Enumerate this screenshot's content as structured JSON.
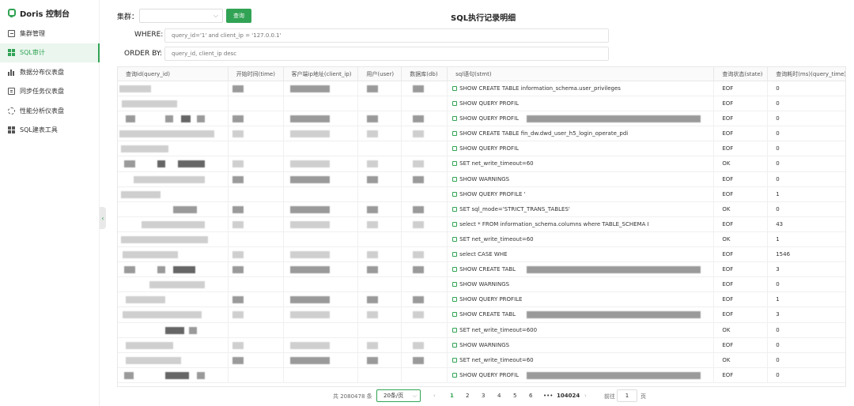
{
  "app": {
    "title": "Doris 控制台"
  },
  "sidebar": {
    "items": [
      {
        "label": "集群管理",
        "icon": "cluster-icon"
      },
      {
        "label": "SQL审计",
        "icon": "grid-icon",
        "active": true
      },
      {
        "label": "数据分布仪表盘",
        "icon": "bar-chart-icon"
      },
      {
        "label": "同步任务仪表盘",
        "icon": "document-icon"
      },
      {
        "label": "性能分析仪表盘",
        "icon": "gear-icon"
      },
      {
        "label": "SQL建表工具",
        "icon": "tiles-icon"
      }
    ]
  },
  "filters": {
    "cluster_label": "集群：",
    "query_button": "查询",
    "where_label": "WHERE:",
    "where_placeholder": "query_id='1' and client_ip = '127.0.0.1'",
    "order_label": "ORDER BY:",
    "order_placeholder": "query_id, client_ip desc"
  },
  "page_title": "SQL执行记录明细",
  "table": {
    "columns": [
      "查询id(query_id)",
      "开始时间(time)",
      "客户端ip地址(client_ip)",
      "用户(user)",
      "数据库(db)",
      "sql语句(stmt)",
      "查询状态(state)",
      "查询耗时(ms)(query_time)"
    ],
    "rows": [
      {
        "stmt": "SHOW CREATE TABLE information_schema.user_privileges",
        "state": "EOF",
        "time": "0"
      },
      {
        "stmt": "SHOW QUERY PROFIL",
        "state": "EOF",
        "time": "0"
      },
      {
        "stmt": "SHOW QUERY PROFIL",
        "state": "EOF",
        "time": "0"
      },
      {
        "stmt": "SHOW CREATE TABLE fin_dw.dwd_user_h5_login_operate_pdi",
        "state": "EOF",
        "time": "0"
      },
      {
        "stmt": "SHOW QUERY PROFIL",
        "state": "EOF",
        "time": "0"
      },
      {
        "stmt": "SET net_write_timeout=60",
        "state": "OK",
        "time": "0"
      },
      {
        "stmt": "SHOW WARNINGS",
        "state": "EOF",
        "time": "0"
      },
      {
        "stmt": "SHOW QUERY PROFILE '",
        "state": "EOF",
        "time": "1"
      },
      {
        "stmt": "SET sql_mode='STRICT_TRANS_TABLES'",
        "state": "OK",
        "time": "0"
      },
      {
        "stmt": "select * FROM information_schema.columns where TABLE_SCHEMA I",
        "state": "EOF",
        "time": "43"
      },
      {
        "stmt": "SET net_write_timeout=60",
        "state": "OK",
        "time": "1"
      },
      {
        "stmt": "select CASE WHE",
        "state": "EOF",
        "time": "1546"
      },
      {
        "stmt": "SHOW CREATE TABL",
        "state": "EOF",
        "time": "3"
      },
      {
        "stmt": "SHOW WARNINGS",
        "state": "EOF",
        "time": "0"
      },
      {
        "stmt": "SHOW QUERY PROFILE",
        "state": "EOF",
        "time": "1"
      },
      {
        "stmt": "SHOW CREATE TABL",
        "state": "EOF",
        "time": "3"
      },
      {
        "stmt": "SET net_write_timeout=600",
        "state": "OK",
        "time": "0"
      },
      {
        "stmt": "SHOW WARNINGS",
        "state": "EOF",
        "time": "0"
      },
      {
        "stmt": "SET net_write_timeout=60",
        "state": "OK",
        "time": "0"
      },
      {
        "stmt": "SHOW QUERY PROFIL",
        "state": "EOF",
        "time": "0"
      }
    ]
  },
  "pagination": {
    "total": "共 2080478 条",
    "page_size": "20条/页",
    "pages": [
      "1",
      "2",
      "3",
      "4",
      "5",
      "6"
    ],
    "ellipsis": "•••",
    "last_page": "104024",
    "prev": "‹",
    "next": "›",
    "goto_label": "前往",
    "goto_value": "1",
    "page_suffix": "页"
  },
  "colors": {
    "accent": "#31a354"
  }
}
